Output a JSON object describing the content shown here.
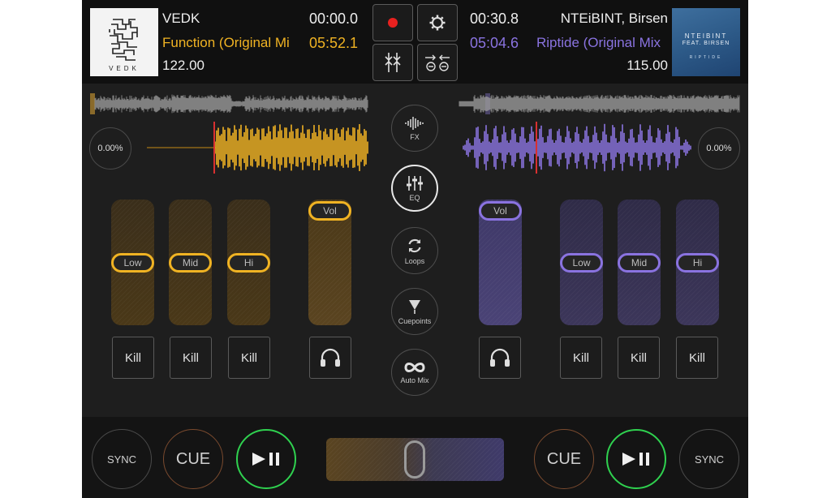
{
  "deck_left": {
    "artist": "VEDK",
    "title": "Function (Original Mi",
    "bpm": "122.00",
    "elapsed": "00:00.0",
    "remaining": "05:52.1",
    "pitch": "0.00%",
    "eq": {
      "low": "Low",
      "mid": "Mid",
      "hi": "Hi"
    },
    "vol": "Vol",
    "kill": "Kill",
    "cue": "CUE",
    "sync": "SYNC",
    "art_text": "VEDK"
  },
  "deck_right": {
    "artist": "NTEiBINT, Birsen",
    "title": "Riptide (Original Mix",
    "bpm": "115.00",
    "elapsed": "00:30.8",
    "remaining": "05:04.6",
    "pitch": "0.00%",
    "eq": {
      "low": "Low",
      "mid": "Mid",
      "hi": "Hi"
    },
    "vol": "Vol",
    "kill": "Kill",
    "cue": "CUE",
    "sync": "SYNC",
    "art_text_1": "NTEIBINT",
    "art_text_2": "FEAT. BIRSEN",
    "art_text_3": "RIPTIDE"
  },
  "nav": {
    "fx": "FX",
    "eq": "EQ",
    "loops": "Loops",
    "cuepoints": "Cuepoints",
    "automix": "Auto Mix"
  },
  "colors": {
    "deck_left_accent": "#f0b323",
    "deck_right_accent": "#8a73e0",
    "play_ring": "#2fd14f",
    "record": "#e8211f"
  },
  "icons": {
    "record": "record-icon",
    "settings": "gear-icon",
    "mixer": "mixer-icon",
    "sync_arrows": "sync-arrows-icon",
    "headphones": "headphones-icon",
    "play_pause": "play-pause-icon",
    "fx": "waveform-icon",
    "eq": "eq-sliders-icon",
    "loops": "loop-icon",
    "cuepoints": "cuepoint-icon",
    "automix": "infinity-icon"
  }
}
